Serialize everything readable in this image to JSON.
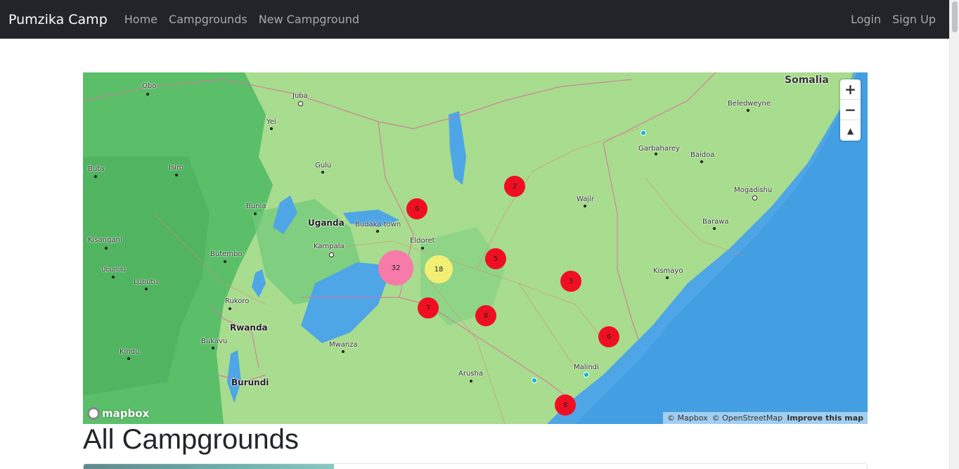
{
  "nav": {
    "brand": "Pumzika Camp",
    "links": [
      "Home",
      "Campgrounds",
      "New Campground"
    ],
    "right_links": [
      "Login",
      "Sign Up"
    ]
  },
  "map": {
    "labels": {
      "somalia": "Somalia",
      "uganda": "Uganda",
      "rwanda": "Rwanda",
      "burundi": "Burundi",
      "obo": "Obo",
      "juba": "Juba",
      "yei": "Yei",
      "buta": "Buta",
      "isiro": "Isiro",
      "gulu": "Gulu",
      "bunia": "Bunia",
      "budaka": "Budaka town",
      "kisangani": "Kisangani",
      "butembo": "Butembo",
      "kampala": "Kampala",
      "eldoret": "Eldoret",
      "ubundu": "Ubundu",
      "lubutu": "Lubutu",
      "rukoro": "Rukoro",
      "bukavu": "Bukavu",
      "kindu": "Kindu",
      "mwanza": "Mwanza",
      "arusha": "Arusha",
      "malindi": "Malindi",
      "wajir": "Wajir",
      "garbaharey": "Garbaharey",
      "baidoa": "Baidoa",
      "beledweyne": "Beledweyne",
      "mogadishu": "Mogadishu",
      "barawa": "Barawa",
      "kismayo": "Kismayo"
    },
    "clusters": [
      {
        "count": "2",
        "color": "red"
      },
      {
        "count": "6",
        "color": "red"
      },
      {
        "count": "5",
        "color": "red"
      },
      {
        "count": "32",
        "color": "pink"
      },
      {
        "count": "18",
        "color": "yellow"
      },
      {
        "count": "3",
        "color": "red"
      },
      {
        "count": "7",
        "color": "red"
      },
      {
        "count": "8",
        "color": "red"
      },
      {
        "count": "6",
        "color": "red"
      },
      {
        "count": "8",
        "color": "red"
      }
    ],
    "cluster_colors": {
      "red": "#f00f22",
      "pink": "#f77ba8",
      "yellow": "#f1f075"
    },
    "controls": {
      "zoom_in": "+",
      "zoom_out": "−",
      "compass": "▲"
    },
    "logo": "mapbox",
    "attribution": {
      "mapbox": "© Mapbox",
      "osm": "© OpenStreetMap",
      "improve": "Improve this map"
    }
  },
  "page": {
    "title": "All Campgrounds"
  }
}
